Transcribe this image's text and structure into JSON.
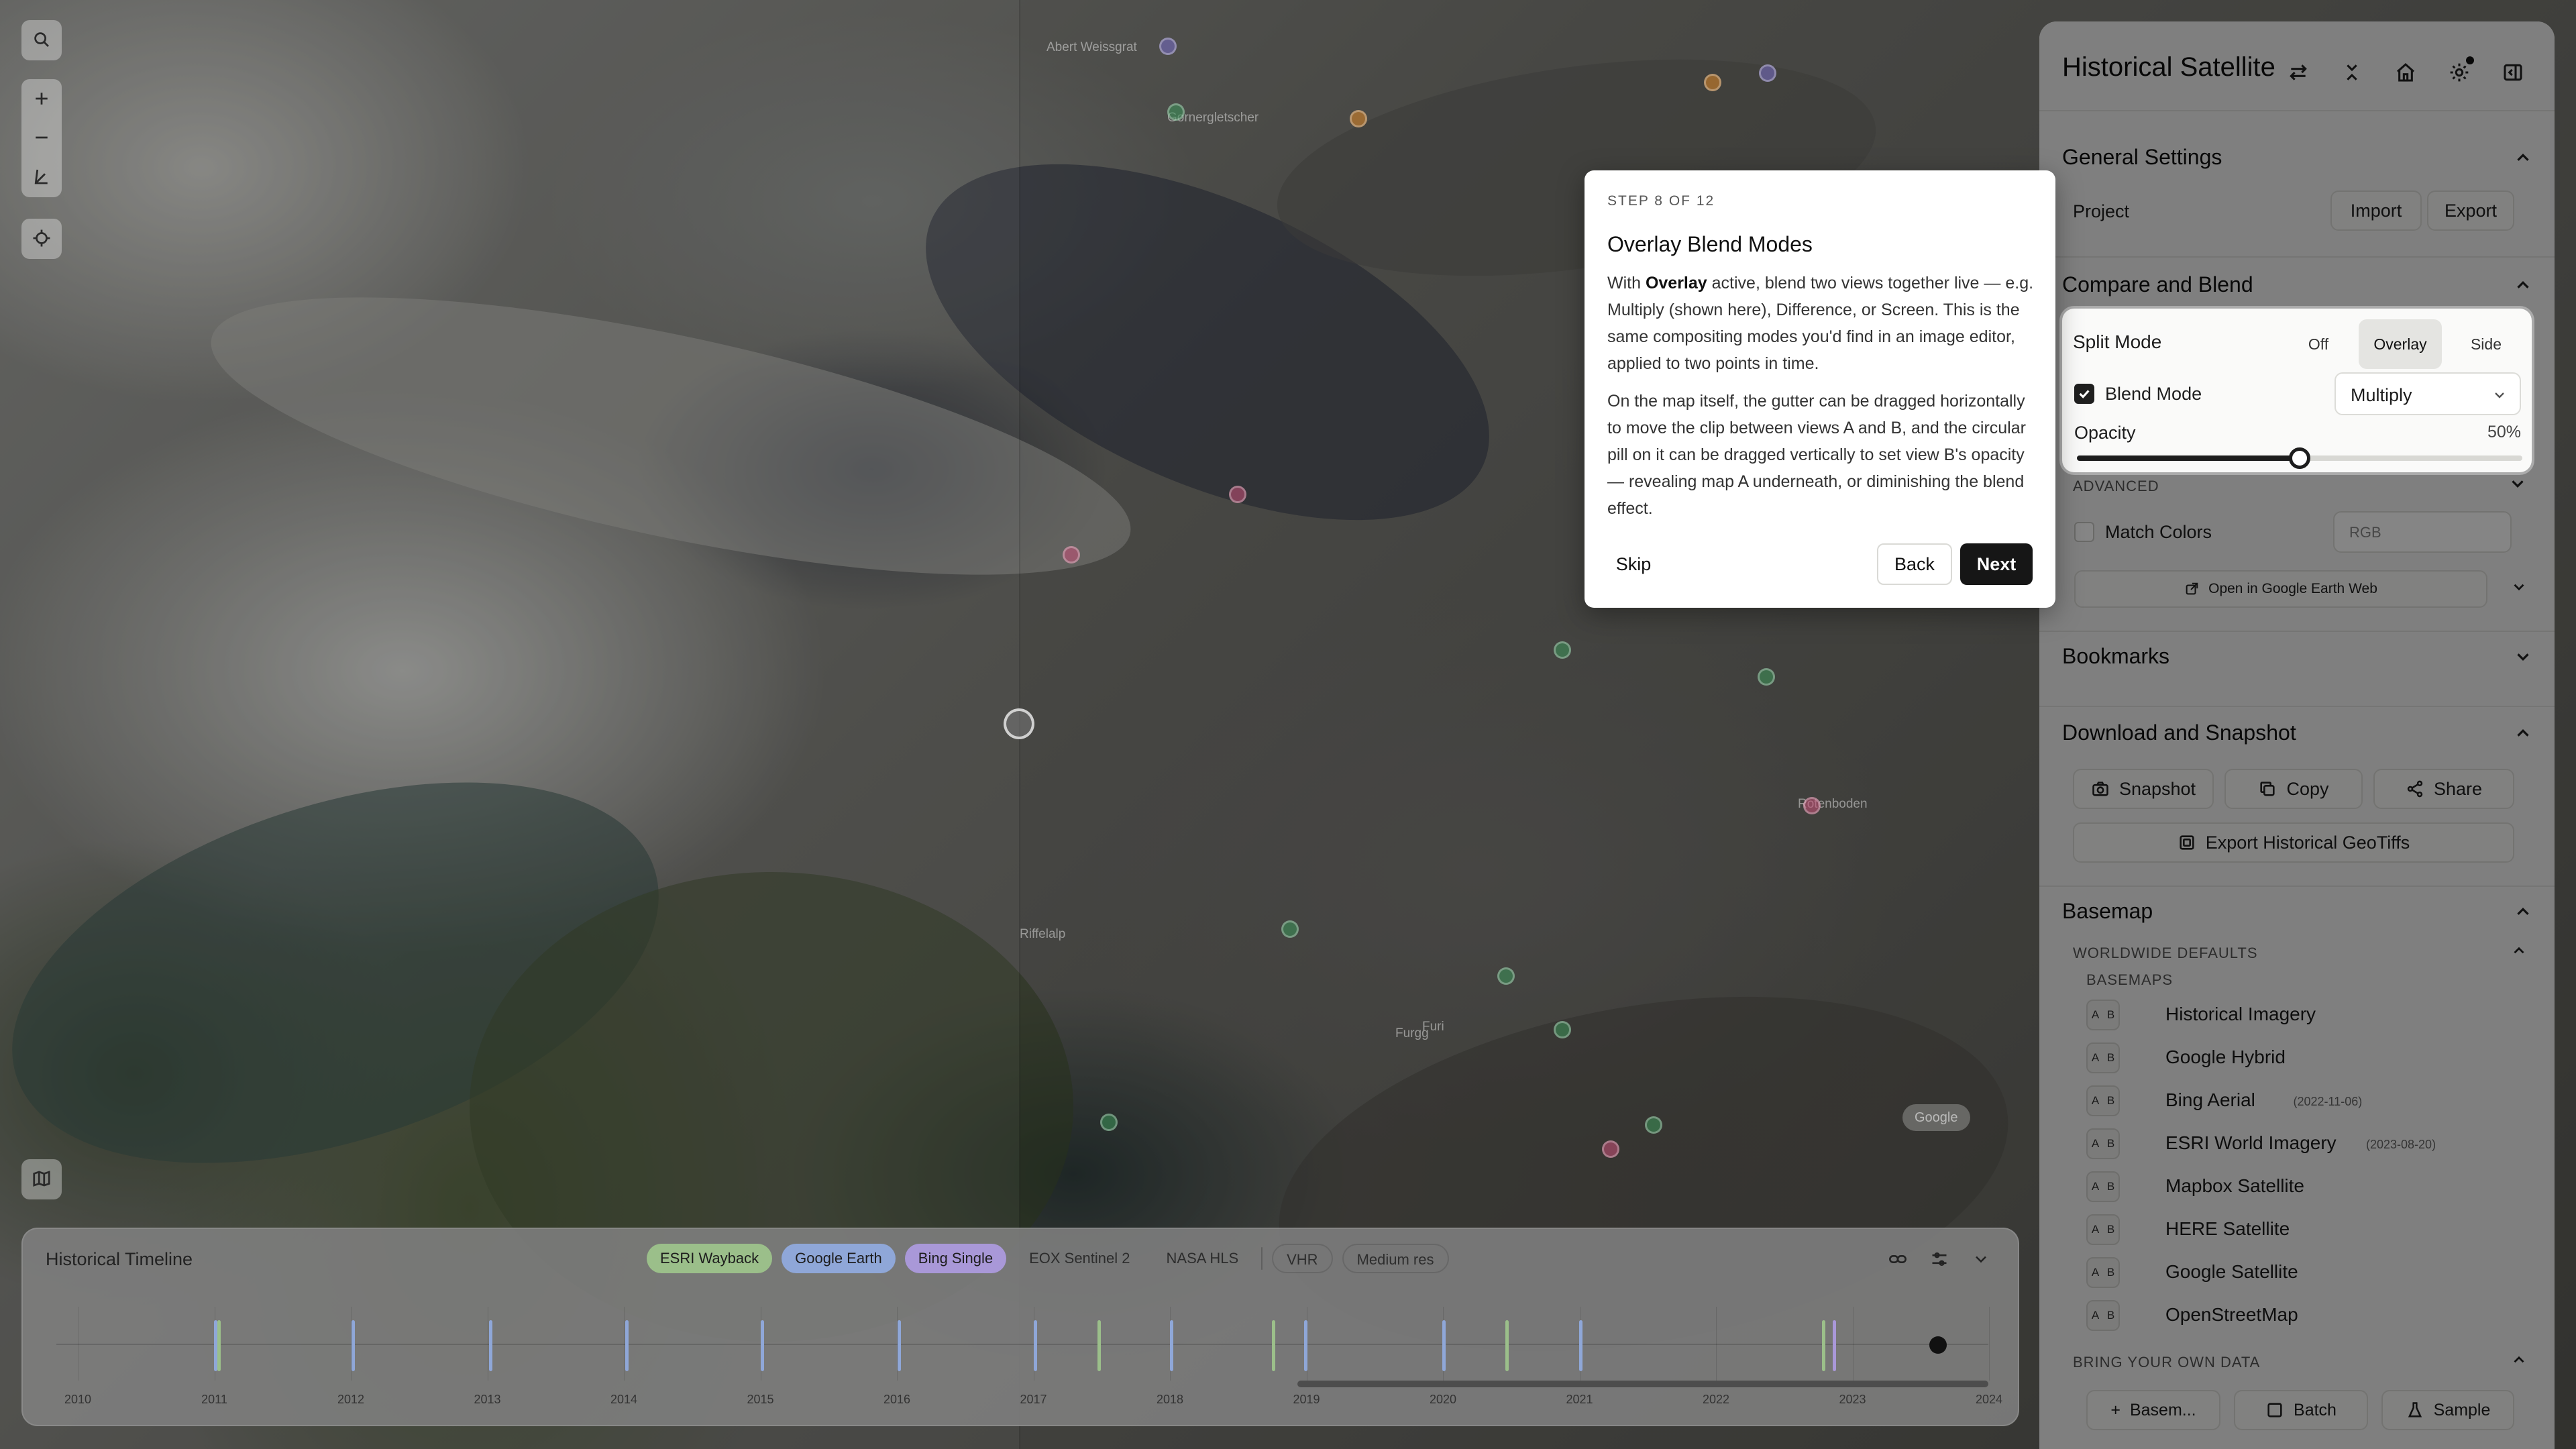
{
  "map": {
    "place_labels": [
      "Abert Weissgrat",
      "Gornergletscher",
      "Rotenboden",
      "Riffelalp",
      "Furi",
      "Furgg"
    ],
    "attribution": "Google",
    "controls": [
      "search-icon",
      "zoom-in-icon",
      "zoom-out-icon",
      "measure-icon",
      "locate-icon",
      "layers-icon"
    ]
  },
  "timeline": {
    "title": "Historical Timeline",
    "sources": [
      {
        "label": "ESRI Wayback",
        "color": "#9bbf8a"
      },
      {
        "label": "Google Earth",
        "color": "#8fa7d8"
      },
      {
        "label": "Bing Single",
        "color": "#a998d8"
      },
      {
        "label": "EOX Sentinel 2",
        "color": "#8a8a8a"
      },
      {
        "label": "NASA HLS",
        "color": "#8a8a8a"
      }
    ],
    "filters": [
      "VHR",
      "Medium res"
    ],
    "years": [
      "2010",
      "2011",
      "2012",
      "2013",
      "2014",
      "2015",
      "2016",
      "2017",
      "2018",
      "2019",
      "2020",
      "2021",
      "2022",
      "2023",
      "2024"
    ],
    "icons": [
      "link-icon",
      "sliders-icon",
      "chevron-down-icon"
    ]
  },
  "sidebar": {
    "title": "Historical Satellite",
    "header_icons": [
      "swap-icon",
      "collapse-icon",
      "home-icon",
      "settings-icon",
      "panel-icon"
    ],
    "general": {
      "title": "General Settings",
      "project_label": "Project",
      "import_label": "Import",
      "export_label": "Export"
    },
    "compare": {
      "title": "Compare and Blend",
      "split_label": "Split Mode",
      "split_options": [
        "Off",
        "Overlay",
        "Side"
      ],
      "split_selected": "Overlay",
      "blend_label": "Blend Mode",
      "blend_value": "Multiply",
      "opacity_label": "Opacity",
      "opacity_value": "50%",
      "opacity_fraction": 0.5,
      "advanced_label": "ADVANCED",
      "match_colors_label": "Match Colors",
      "match_colors_value": "RGB",
      "google_earth_link": "Open in Google Earth Web"
    },
    "bookmarks": {
      "title": "Bookmarks"
    },
    "download": {
      "title": "Download and Snapshot",
      "snapshot": "Snapshot",
      "copy": "Copy",
      "share": "Share",
      "export_geotiffs": "Export Historical GeoTiffs"
    },
    "basemap": {
      "title": "Basemap",
      "worldwide_label": "WORLDWIDE DEFAULTS",
      "basemaps_label": "BASEMAPS",
      "items": [
        {
          "name": "Historical Imagery",
          "date": ""
        },
        {
          "name": "Google Hybrid",
          "date": ""
        },
        {
          "name": "Bing Aerial",
          "date": "(2022-11-06)"
        },
        {
          "name": "ESRI World Imagery",
          "date": "(2023-08-20)"
        },
        {
          "name": "Mapbox Satellite",
          "date": ""
        },
        {
          "name": "HERE Satellite",
          "date": ""
        },
        {
          "name": "Google Satellite",
          "date": ""
        },
        {
          "name": "OpenStreetMap",
          "date": ""
        }
      ],
      "ab_a": "A",
      "ab_b": "B",
      "byo_label": "BRING YOUR OWN DATA",
      "byo_buttons": [
        "Basem...",
        "Batch",
        "Sample"
      ]
    }
  },
  "tour": {
    "step": "STEP 8 OF 12",
    "title": "Overlay Blend Modes",
    "p1_prefix": "With ",
    "p1_bold": "Overlay",
    "p1_rest": " active, blend two views together live — e.g. Multiply (shown here), Difference, or Screen. This is the same compositing modes you'd find in an image editor, applied to two points in time.",
    "p2": "On the map itself, the gutter can be dragged horizontally to move the clip between views A and B, and the circular pill on it can be dragged vertically to set view B's opacity — revealing map A underneath, or diminishing the blend effect.",
    "skip": "Skip",
    "back": "Back",
    "next": "Next"
  }
}
